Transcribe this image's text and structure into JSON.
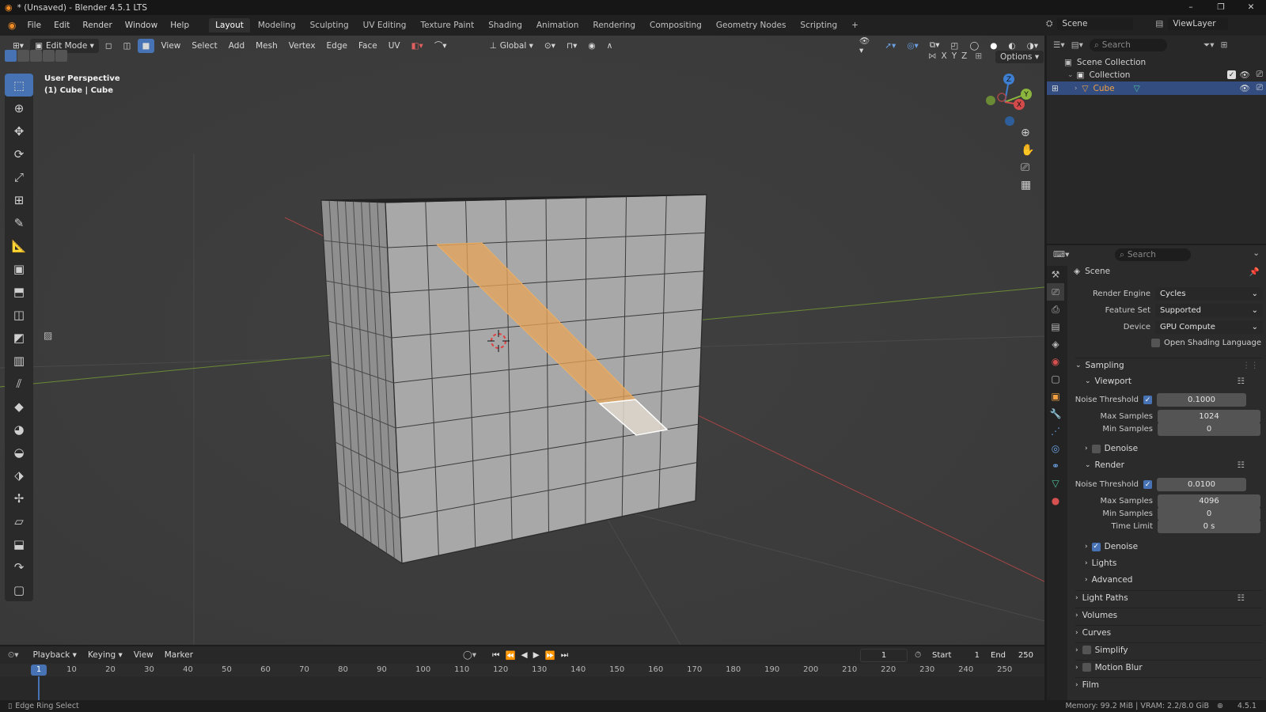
{
  "window": {
    "title": "* (Unsaved) - Blender 4.5.1 LTS",
    "minimize": "–",
    "maximize": "❐",
    "close": "✕"
  },
  "menu": {
    "items": [
      "File",
      "Edit",
      "Render",
      "Window",
      "Help"
    ]
  },
  "workspaces": [
    "Layout",
    "Modeling",
    "Sculpting",
    "UV Editing",
    "Texture Paint",
    "Shading",
    "Animation",
    "Rendering",
    "Compositing",
    "Geometry Nodes",
    "Scripting"
  ],
  "add_workspace": "+",
  "scene": {
    "label": "Scene",
    "viewlayer": "ViewLayer"
  },
  "viewport": {
    "mode": "Edit Mode",
    "menus": [
      "View",
      "Select",
      "Add",
      "Mesh",
      "Vertex",
      "Edge",
      "Face",
      "UV"
    ],
    "orientation": "Global",
    "options": "Options",
    "axes": [
      "X",
      "Y",
      "Z"
    ],
    "overlay_line1": "User Perspective",
    "overlay_line2": "(1) Cube | Cube",
    "gizmo": {
      "x": "X",
      "y": "Y",
      "z": "Z"
    }
  },
  "outliner": {
    "search_placeholder": "Search",
    "scene_collection": "Scene Collection",
    "collection": "Collection",
    "cube": "Cube"
  },
  "properties": {
    "search_placeholder": "Search",
    "context": "Scene",
    "render_engine_label": "Render Engine",
    "render_engine": "Cycles",
    "feature_set_label": "Feature Set",
    "feature_set": "Supported",
    "device_label": "Device",
    "device": "GPU Compute",
    "osl_label": "Open Shading Language",
    "sampling": "Sampling",
    "viewport_sec": "Viewport",
    "noise_threshold_label": "Noise Threshold",
    "vp_noise": "0.1000",
    "max_samples_label": "Max Samples",
    "vp_max": "1024",
    "min_samples_label": "Min Samples",
    "vp_min": "0",
    "denoise_label": "Denoise",
    "render_sec": "Render",
    "r_noise": "0.0100",
    "r_max": "4096",
    "r_min": "0",
    "time_limit_label": "Time Limit",
    "r_time": "0 s",
    "lights": "Lights",
    "advanced": "Advanced",
    "light_paths": "Light Paths",
    "volumes": "Volumes",
    "curves": "Curves",
    "simplify": "Simplify",
    "motion_blur": "Motion Blur",
    "film": "Film"
  },
  "timeline": {
    "menus": [
      "Playback",
      "Keying",
      "View",
      "Marker"
    ],
    "current_frame": "1",
    "start_label": "Start",
    "start": "1",
    "end_label": "End",
    "end": "250",
    "ticks": [
      "10",
      "20",
      "30",
      "40",
      "50",
      "60",
      "70",
      "80",
      "90",
      "100",
      "110",
      "120",
      "130",
      "140",
      "150",
      "160",
      "170",
      "180",
      "190",
      "200",
      "210",
      "220",
      "230",
      "240",
      "250"
    ],
    "playhead": "1"
  },
  "status": {
    "left": "Edge Ring Select",
    "right": "Memory: 99.2 MiB | VRAM: 2.2/8.0 GiB",
    "version": "4.5.1"
  },
  "colors": {
    "accent": "#4772b3",
    "selection": "#e8a55a",
    "x_axis": "#d24a4a",
    "y_axis": "#8cb53d",
    "z_axis": "#3f7fd1"
  }
}
